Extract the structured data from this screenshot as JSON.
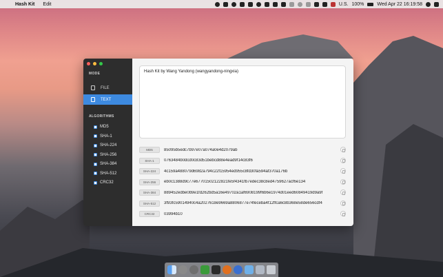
{
  "menubar": {
    "app_name": "Hash Kit",
    "menus": [
      "Edit"
    ],
    "status": {
      "locale": "U.S.",
      "battery": "100%",
      "datetime": "Wed Apr 22  16:19:58"
    }
  },
  "window": {
    "sidebar": {
      "mode_title": "MODE",
      "modes": [
        {
          "label": "FILE",
          "active": false
        },
        {
          "label": "TEXT",
          "active": true
        }
      ],
      "algorithms_title": "ALGORITHMS",
      "algorithms": [
        "MD5",
        "SHA-1",
        "SHA-224",
        "SHA-256",
        "SHA-384",
        "SHA-512",
        "CRC32"
      ]
    },
    "input_text": "Hash Kit by Wang Yandong (wangyandong-ningxia)",
    "results": [
      {
        "algorithm": "MD5",
        "value": "85095b5edc7b97e07a074a0e4d2079ab"
      },
      {
        "algorithm": "SHA-1",
        "value": "0763484b0dcd0c83d51bebcd88e4ead9f14c83f6"
      },
      {
        "algorithm": "SHA-224",
        "value": "4c159a488079d6982a794c22f15954ed955c8fd30fa594af370a176b"
      },
      {
        "algorithm": "SHA-256",
        "value": "eb0c1388d9c77e67701502122821fe5f4341fb7edec38c8ed4759627acf6e134"
      },
      {
        "algorithm": "SHA-384",
        "value": "889452edbe0b9e1fd262bd5a16e49702a1af6908199f6b6e1974d01eed60849419d9a9f"
      },
      {
        "algorithm": "SHA-512",
        "value": "3f93fc59014940c4a2027618e9669a8806877e74feceba4f12ffca6c8b368e58de656cdf4"
      },
      {
        "algorithm": "CRC32",
        "value": "03994b10"
      }
    ]
  },
  "colors": {
    "accent": "#3d8ae0",
    "sidebar_bg": "#2d2d2d",
    "traffic_red": "#fc605b",
    "traffic_yellow": "#fdbc40",
    "traffic_green": "#34c84a"
  },
  "dock_icons": [
    "finder-icon",
    "launchpad-icon",
    "settings-icon",
    "app-store-icon",
    "terminal-icon",
    "firefox-icon",
    "xcode-icon",
    "folder-icon",
    "preview-icon",
    "trash-icon"
  ]
}
